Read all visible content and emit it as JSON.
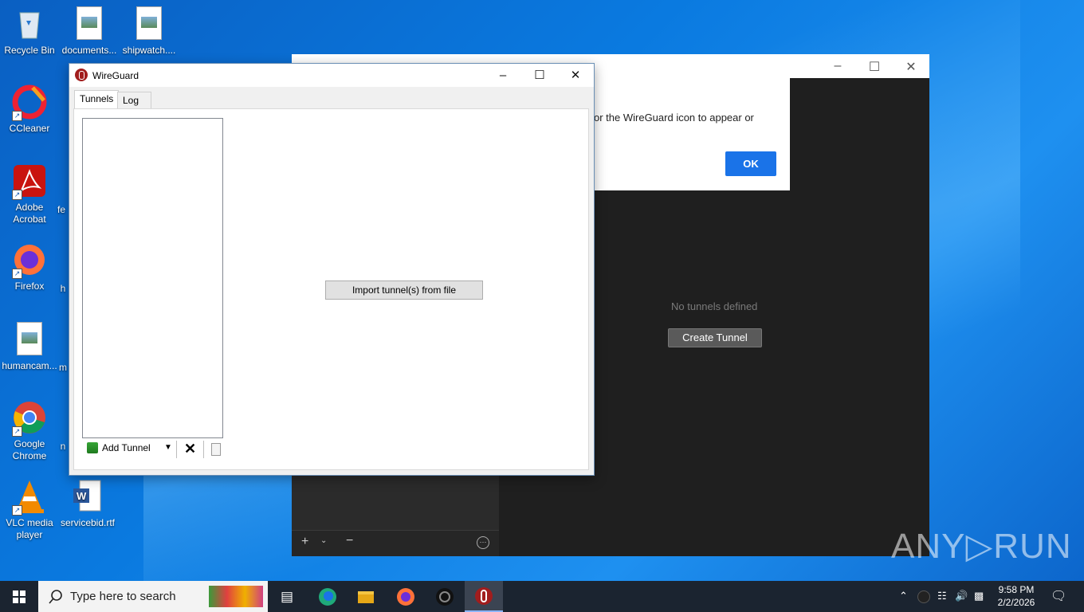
{
  "desktop": {
    "icons": [
      {
        "label": "Recycle Bin",
        "icon": "recycle-bin-icon"
      },
      {
        "label": "documents...",
        "icon": "image-file-icon"
      },
      {
        "label": "shipwatch....",
        "icon": "image-file-icon"
      },
      {
        "label": "CCleaner",
        "icon": "ccleaner-icon"
      },
      {
        "label": "Adobe Acrobat",
        "icon": "adobe-acrobat-icon"
      },
      {
        "label": "Firefox",
        "icon": "firefox-icon"
      },
      {
        "label": "humancam...",
        "icon": "image-file-icon"
      },
      {
        "label": "Google Chrome",
        "icon": "chrome-icon"
      },
      {
        "label": "VLC media player",
        "icon": "vlc-icon"
      },
      {
        "label": "servicebid.rtf",
        "icon": "word-document-icon"
      }
    ],
    "partial_labels": [
      "fe",
      "h",
      "m",
      "n"
    ]
  },
  "background_window": {
    "empty_text": "No tunnels defined",
    "create_button": "Create Tunnel",
    "add_symbol": "+",
    "remove_symbol": "−"
  },
  "dialog": {
    "message": "or the WireGuard icon to appear or",
    "ok_label": "OK"
  },
  "wireguard": {
    "title": "WireGuard",
    "tabs": [
      "Tunnels",
      "Log"
    ],
    "import_button": "Import tunnel(s) from file",
    "add_tunnel": "Add Tunnel"
  },
  "taskbar": {
    "search_placeholder": "Type here to search",
    "time": "9:58 PM",
    "date": "2/2/2026"
  },
  "watermark": "ANY▷RUN",
  "colors": {
    "accent": "#1a73e8",
    "desktop": "#0a7ae0",
    "wireguard_red": "#a11d1d"
  }
}
